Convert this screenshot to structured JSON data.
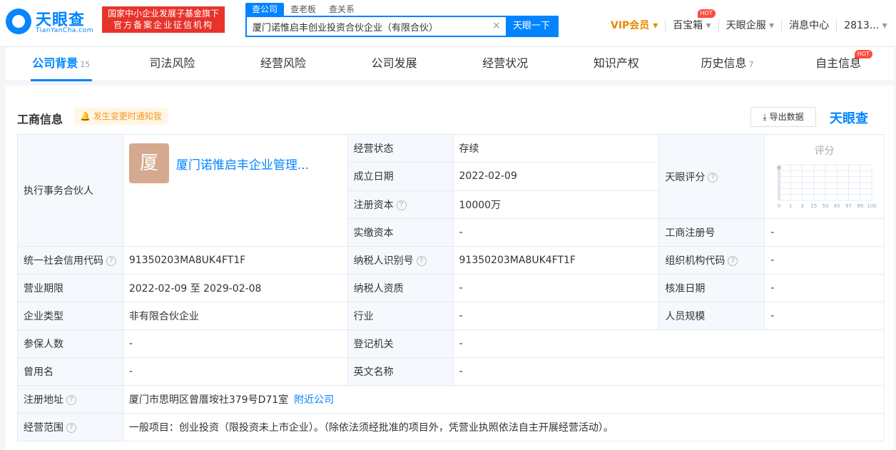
{
  "header": {
    "logo_text": "天眼查",
    "logo_sub": "TianYanCha.com",
    "banner_line1": "国家中小企业发展子基金旗下",
    "banner_line2": "官方备案企业征信机构",
    "search_tabs": [
      "查公司",
      "查老板",
      "查关系"
    ],
    "search_value": "厦门诺惟启丰创业投资合伙企业（有限合伙）",
    "search_button": "天眼一下",
    "nav": {
      "vip": "VIP会员",
      "baibao": "百宝箱",
      "hot": "HOT",
      "qifu": "天眼企服",
      "messages": "消息中心",
      "user": "2813..."
    }
  },
  "subnav": {
    "tabs": [
      {
        "label": "公司背景",
        "count": "15"
      },
      {
        "label": "司法风险"
      },
      {
        "label": "经营风险"
      },
      {
        "label": "公司发展"
      },
      {
        "label": "经营状况"
      },
      {
        "label": "知识产权"
      },
      {
        "label": "历史信息",
        "count": "7"
      },
      {
        "label": "自主信息",
        "hot": "HOT"
      }
    ]
  },
  "panel": {
    "title": "工商信息",
    "notify": "发生变更时通知我",
    "export": "导出数据",
    "brand": "天眼查"
  },
  "info": {
    "partner_label": "执行事务合伙人",
    "partner_avatar": "厦",
    "partner_name": "厦门诺惟启丰企业管理...",
    "status_label": "经营状态",
    "status": "存续",
    "founded_label": "成立日期",
    "founded": "2022-02-09",
    "capital_label": "注册资本",
    "capital": "10000万",
    "paid_label": "实缴资本",
    "paid": "-",
    "score_label": "天眼评分",
    "score_title": "评分",
    "score_ticks": [
      "0",
      "1",
      "3",
      "15",
      "50",
      "85",
      "97",
      "99",
      "100"
    ],
    "reg_no_label": "工商注册号",
    "reg_no": "-",
    "credit_label": "统一社会信用代码",
    "credit": "91350203MA8UK4FT1F",
    "taxid_label": "纳税人识别号",
    "taxid": "91350203MA8UK4FT1F",
    "org_label": "组织机构代码",
    "org": "-",
    "term_label": "营业期限",
    "term": "2022-02-09  至 2029-02-08",
    "taxq_label": "纳税人资质",
    "taxq": "-",
    "approve_label": "核准日期",
    "approve": "-",
    "type_label": "企业类型",
    "type": "非有限合伙企业",
    "industry_label": "行业",
    "industry": "-",
    "staff_label": "人员规模",
    "staff": "-",
    "insured_label": "参保人数",
    "insured": "-",
    "authority_label": "登记机关",
    "authority": "-",
    "former_label": "曾用名",
    "former": "-",
    "english_label": "英文名称",
    "english": "-",
    "address_label": "注册地址",
    "address": "厦门市思明区曾厝垵社379号D71室",
    "nearby": "附近公司",
    "scope_label": "经营范围",
    "scope": "一般项目：创业投资（限投资未上市企业）。（除依法须经批准的项目外，凭营业执照依法自主开展经营活动）。"
  }
}
